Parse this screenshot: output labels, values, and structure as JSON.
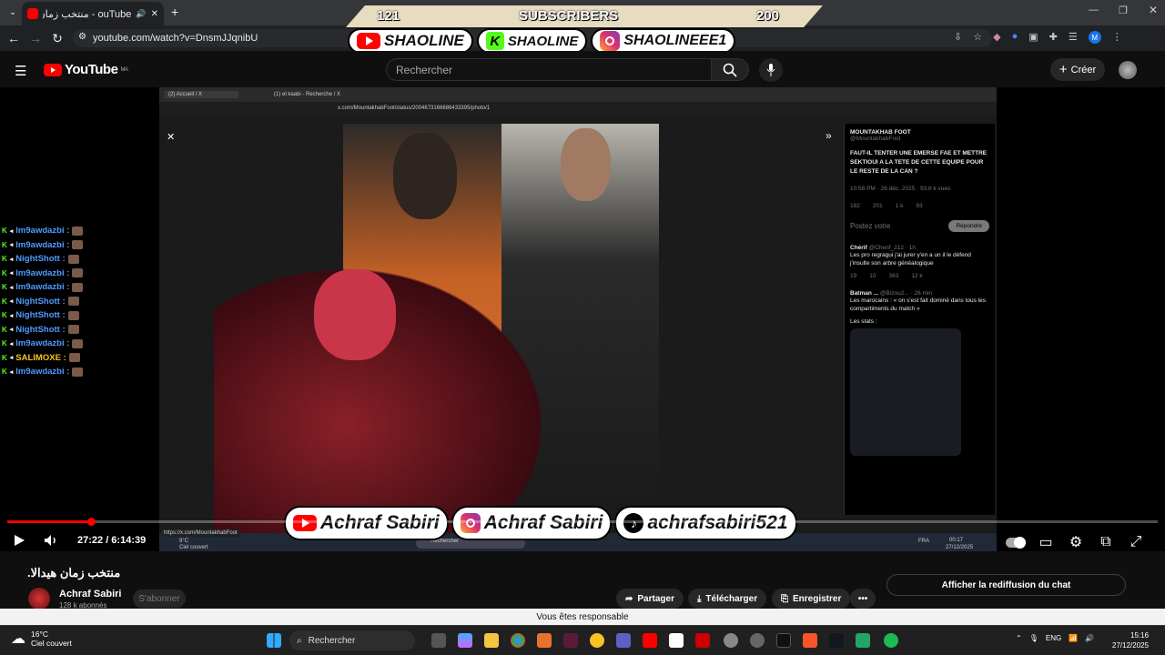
{
  "browser": {
    "tab_title": "ouTube - منتخب زمان هيدالا",
    "url": "youtube.com/watch?v=DnsmJJqnibU"
  },
  "youtube": {
    "logo": "YouTube",
    "region": "MA",
    "search_placeholder": "Rechercher",
    "create_label": "Créer"
  },
  "overlay": {
    "left_count": "121",
    "label": "SUBSCRIBERS",
    "right_count": "200",
    "top_handles": [
      "SHAOLINE",
      "SHAOLINE",
      "SHAOLINEEE1"
    ],
    "bottom_handles": [
      "Achraf Sabiri",
      "Achraf Sabiri",
      "achrafsabiri521"
    ]
  },
  "inner_screen": {
    "tab1": "(2) Accueil / X",
    "tab2": "(1) el kaabi - Recherche / X",
    "url": "x.com/MountakhabFoot/status/2004673166686433395/photo/1",
    "tweet_author": "MOUNTAKHAB FOOT",
    "tweet_handle": "@MountakhabFoot",
    "tweet_text": "FAUT-IL TENTER UNE EMERSE FAE ET METTRE SEKTIOUI A LA TETE DE CETTE EQUIPE POUR LE RESTE DE LA CAN ?",
    "tweet_meta": "10:58 PM · 26 déc. 2025 · 93,6 k vues",
    "tweet_stats": [
      "182",
      "201",
      "1 k",
      "93"
    ],
    "reply_placeholder": "Postez votre",
    "reply_button": "Répondre",
    "reply1_author": "Chérif",
    "reply1_handle": "@Cherif_212 · 1h",
    "reply1_text": "Les pro regragui j'ai jurer y'en a un il le défend j'insulte son arbre généalogique",
    "reply1_stats": [
      "19",
      "10",
      "363",
      "12 k"
    ],
    "reply2_author": "Batman ...",
    "reply2_handle": "@Bizou2... · 26 min",
    "reply2_text": "Les marocains : « on s'est fait dominé dans tous les compartiments du match »",
    "reply2_sub": "Les stats :",
    "status_link": "https://x.com/MountakhabFoot",
    "weather_temp": "9°C",
    "weather_desc": "Ciel couvert",
    "search": "Rechercher",
    "lang": "FRA",
    "time": "00:17",
    "date": "27/12/2025"
  },
  "chat": [
    {
      "name": "lm9awdazbi :"
    },
    {
      "name": "lm9awdazbi :"
    },
    {
      "name": "NightShott :"
    },
    {
      "name": "lm9awdazbi :"
    },
    {
      "name": "lm9awdazbi :"
    },
    {
      "name": "NightShott :"
    },
    {
      "name": "NightShott :"
    },
    {
      "name": "NightShott :"
    },
    {
      "name": "lm9awdazbi :"
    },
    {
      "name": "SALIMOXE :"
    },
    {
      "name": "lm9awdazbi :"
    }
  ],
  "player": {
    "time": "27:22 / 6:14:39",
    "progress": 0.073
  },
  "video_info": {
    "title": "منتخب زمان هيدالا.",
    "channel": "Achraf Sabiri",
    "subscribers": "128 k abonnés",
    "subscribe": "S'abonner",
    "share": "Partager",
    "download": "Télécharger",
    "save": "Enregistrer",
    "chat_replay": "Afficher la rediffusion du chat"
  },
  "notice": "Vous êtes responsable",
  "taskbar": {
    "temp": "16°C",
    "weather": "Ciel couvert",
    "search": "Rechercher",
    "lang": "ENG",
    "time": "15:16",
    "date": "27/12/2025"
  },
  "colors": {
    "accent": "#ff0000",
    "kick": "#53fc18",
    "chat_name": "#4f9cff"
  }
}
